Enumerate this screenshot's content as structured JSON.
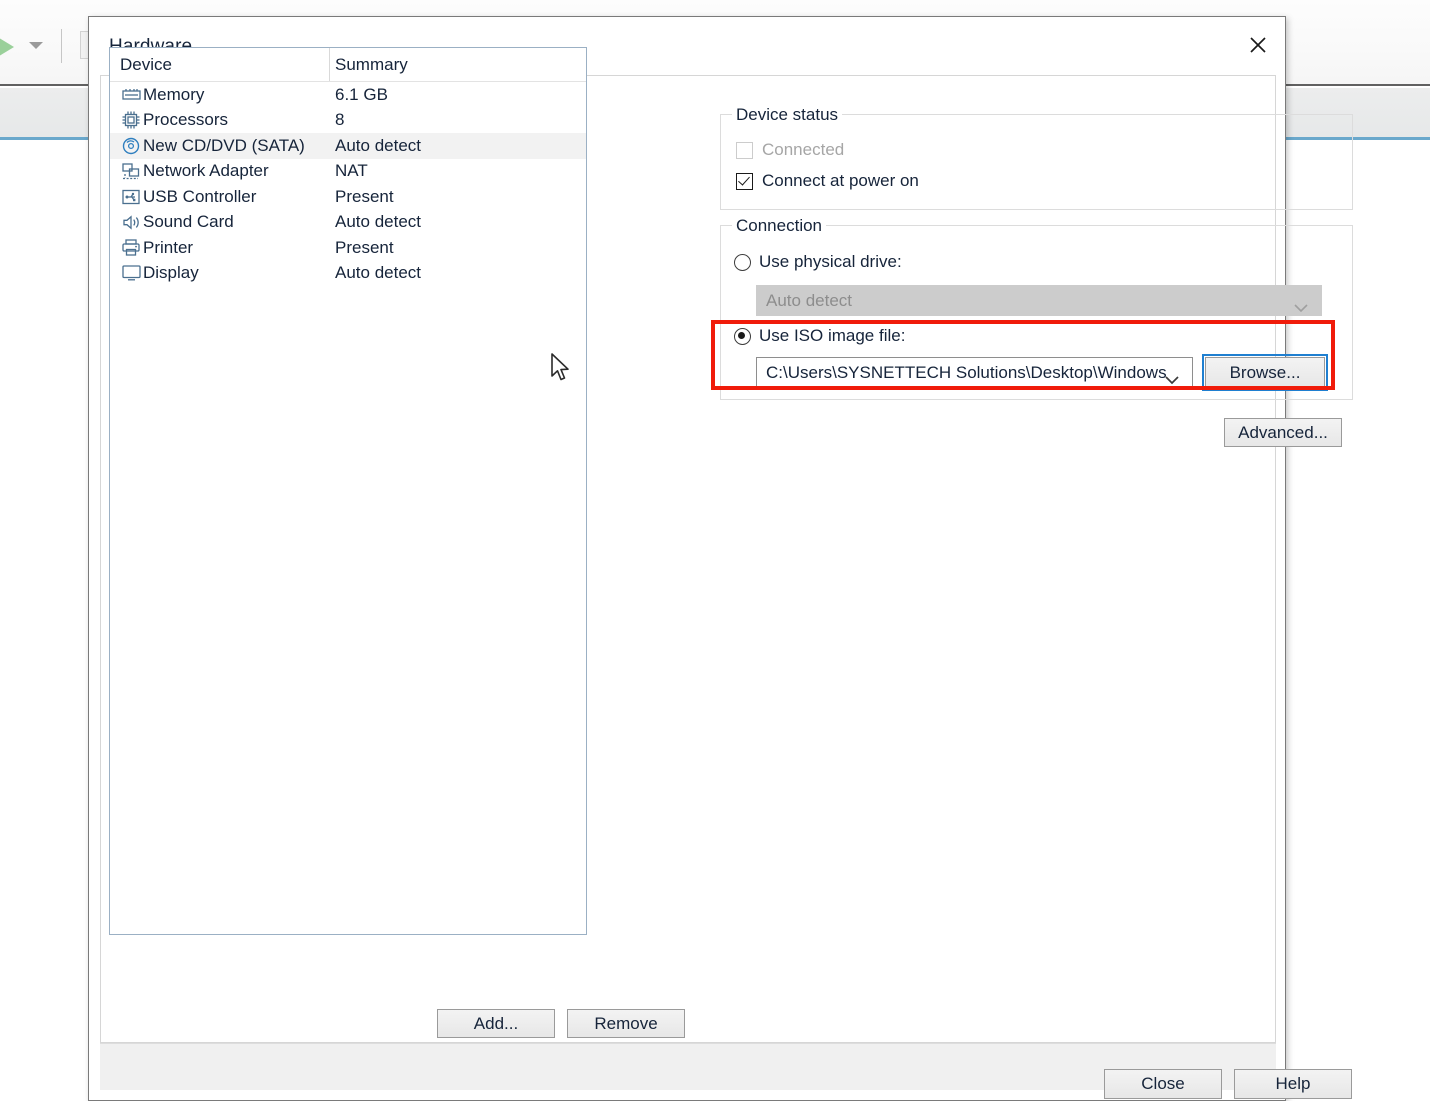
{
  "background": {
    "play_icon": "play-icon",
    "dropdown_icon": "chevron-down-icon"
  },
  "dialog": {
    "title": "Hardware",
    "close_icon": "close-icon"
  },
  "device_list": {
    "columns": [
      "Device",
      "Summary"
    ],
    "rows": [
      {
        "icon": "memory-icon",
        "name": "Memory",
        "summary": "6.1 GB",
        "selected": false
      },
      {
        "icon": "cpu-icon",
        "name": "Processors",
        "summary": "8",
        "selected": false
      },
      {
        "icon": "cd-dvd-icon",
        "name": "New CD/DVD (SATA)",
        "summary": "Auto detect",
        "selected": true
      },
      {
        "icon": "network-icon",
        "name": "Network Adapter",
        "summary": "NAT",
        "selected": false
      },
      {
        "icon": "usb-icon",
        "name": "USB Controller",
        "summary": "Present",
        "selected": false
      },
      {
        "icon": "speaker-icon",
        "name": "Sound Card",
        "summary": "Auto detect",
        "selected": false
      },
      {
        "icon": "printer-icon",
        "name": "Printer",
        "summary": "Present",
        "selected": false
      },
      {
        "icon": "display-icon",
        "name": "Display",
        "summary": "Auto detect",
        "selected": false
      }
    ],
    "add_label": "Add...",
    "remove_label": "Remove"
  },
  "device_status": {
    "legend": "Device status",
    "connected_label": "Connected",
    "connected_checked": false,
    "connected_disabled": true,
    "power_on_label": "Connect at power on",
    "power_on_checked": true
  },
  "connection": {
    "legend": "Connection",
    "physical_label": "Use physical drive:",
    "physical_selected": false,
    "physical_value": "Auto detect",
    "iso_label": "Use ISO image file:",
    "iso_selected": true,
    "iso_value": "C:\\Users\\SYSNETTECH Solutions\\Desktop\\Windows",
    "browse_label": "Browse...",
    "advanced_label": "Advanced...",
    "highlight_color": "#f01b0a",
    "focus_color": "#1f7fd0"
  },
  "footer": {
    "close_label": "Close",
    "help_label": "Help"
  }
}
